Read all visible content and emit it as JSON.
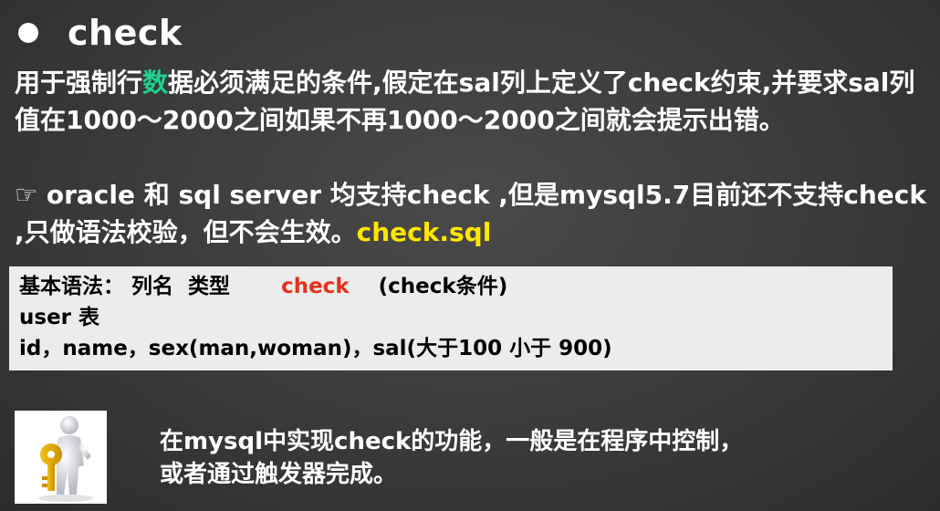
{
  "heading": {
    "title": "check"
  },
  "para1": {
    "pre": "用于强制行",
    "hl": "数",
    "post": "据必须满足的条件,假定在sal列上定义了check约束,并要求sal列值在1000～2000之间如果不再1000～2000之间就会提示出错。"
  },
  "para2": {
    "icon": "☞",
    "text": " oracle 和 sql server 均支持check ,但是mysql5.7目前还不支持check ,只做语法校验，但不会生效。",
    "link": "check.sql"
  },
  "syntax": {
    "row1_pre": "基本语法： 列名  类型       ",
    "row1_kw": "check",
    "row1_post": "    (check条件)",
    "row2": "user 表",
    "row3": "id，name，sex(man,woman)，sal(大于100 小于 900)"
  },
  "note": {
    "line1": "在mysql中实现check的功能，一般是在程序中控制，",
    "line2": "或者通过触发器完成。"
  },
  "image": {
    "icon": "key-person-icon"
  },
  "colors": {
    "highlight_green": "#1ed38c",
    "highlight_yellow": "#ffe600",
    "keyword_red": "#e8301c"
  }
}
